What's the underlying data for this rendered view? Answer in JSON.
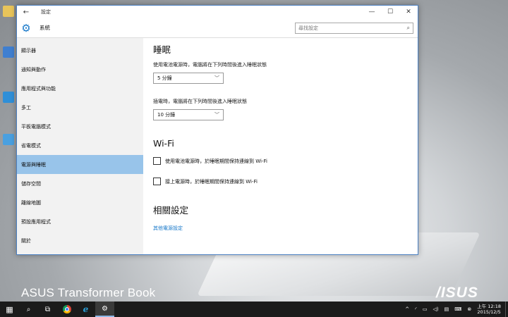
{
  "window": {
    "title": "設定",
    "back_glyph": "←",
    "minimize_glyph": "—",
    "maximize_glyph": "☐",
    "close_glyph": "✕",
    "header_title": "系統",
    "search_placeholder": "尋找設定"
  },
  "sidebar": {
    "items": [
      {
        "label": "顯示器"
      },
      {
        "label": "通知與動作"
      },
      {
        "label": "應用程式與功能"
      },
      {
        "label": "多工"
      },
      {
        "label": "平板電腦模式"
      },
      {
        "label": "省電模式"
      },
      {
        "label": "電源與睡眠",
        "active": true
      },
      {
        "label": "儲存空間"
      },
      {
        "label": "離線地圖"
      },
      {
        "label": "預設應用程式"
      },
      {
        "label": "關於"
      }
    ]
  },
  "sleep": {
    "title": "睡眠",
    "battery_label": "使用電池電源時，電腦將在下列時間後進入睡眠狀態",
    "battery_value": "5 分鐘",
    "plugged_label": "插電時，電腦將在下列時間後進入睡眠狀態",
    "plugged_value": "10 分鐘"
  },
  "wifi": {
    "title": "Wi-Fi",
    "option_battery": "使用電池電源時，於睡眠期間保持連線到 Wi-Fi",
    "option_plugged": "接上電源時，於睡眠期間保持連線到 Wi-Fi"
  },
  "related": {
    "title": "相關設定",
    "link": "其他電源設定"
  },
  "desktop": {
    "brand_left": "ASUS Transformer Book",
    "brand_right": "/ISUS"
  },
  "taskbar": {
    "clock_time": "上午 12:18",
    "clock_date": "2015/12/5"
  },
  "colors": {
    "accent": "#1979ca",
    "nav_active": "#98c4ea",
    "taskbar": "#1b1b1b"
  }
}
